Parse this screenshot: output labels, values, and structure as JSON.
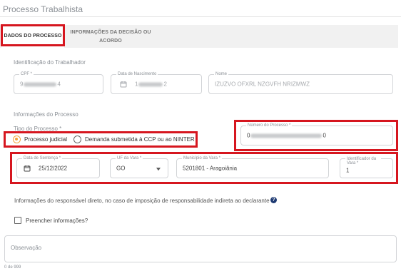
{
  "section": {
    "title": "Processo Trabalhista"
  },
  "tabs": [
    {
      "label": "DADOS DO PROCESSO"
    },
    {
      "label": "INFORMAÇÕES DA DECISÃO OU ACORDO"
    }
  ],
  "worker": {
    "heading": "Identificação do Trabalhador",
    "cpf": {
      "label": "CPF *",
      "value_start": "9",
      "value_end": "4"
    },
    "birth_date": {
      "label": "Data de Nascimento",
      "value_start": "1",
      "value_end": "2"
    },
    "name": {
      "label": "Nome",
      "value": "IZUZVO OFXRL NZGVFH NRIZMWZ"
    }
  },
  "process": {
    "heading": "Informações do Processo",
    "type_label": "Tipo do Processo *",
    "options": [
      {
        "label": "Processo judicial",
        "selected": true
      },
      {
        "label": "Demanda submetida à CCP ou ao NINTER",
        "selected": false
      }
    ],
    "number": {
      "label": "Número do Processo *",
      "value_start": "0",
      "value_end": "0"
    },
    "sentence_date": {
      "label": "Data de Sentença *",
      "value": "25/12/2022"
    },
    "uf": {
      "label": "UF da Vara *",
      "value": "GO"
    },
    "municipality": {
      "label": "Município da Vara *",
      "value": "5201801 - Aragoiânia"
    },
    "court_id": {
      "label": "Identificador da Vara *",
      "value": "1"
    }
  },
  "responsible": {
    "text": "Informações do responsável direto, no caso de imposição de responsabilidade indireta ao declarante",
    "help_icon": "?",
    "checkbox_label": "Preencher informações?"
  },
  "observation": {
    "placeholder": "Observação",
    "counter": "0 de 999"
  },
  "colors": {
    "highlight_red": "#d6161f",
    "radio_accent": "#f3a43a",
    "help_icon_bg": "#1f3b73"
  }
}
